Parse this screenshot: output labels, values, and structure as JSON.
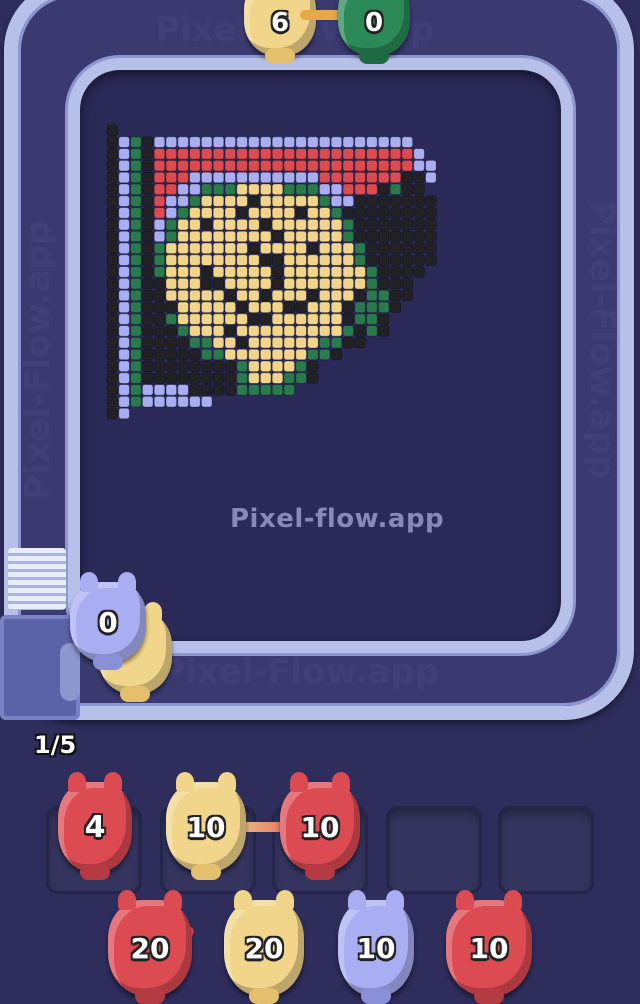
{
  "watermark": {
    "center": "Pixel-flow.app",
    "bottom_track": "Pixel-Flow.app",
    "top_track": "Pixel-Flow.app",
    "side_track": "Pixel-Flow.app"
  },
  "level_progress": "1/5",
  "colors": {
    "red": "#dc4a52",
    "yellow": "#f1d58a",
    "blue": "#a9aef2",
    "green": "#2b7a4e",
    "black": "#222226"
  },
  "track_pigs": [
    {
      "count": "6",
      "color": "yellow"
    },
    {
      "count": "0",
      "color": "green"
    },
    {
      "count": "0",
      "color": "blue"
    }
  ],
  "slots": [
    {
      "count": "4",
      "color": "red"
    },
    {
      "count": "10",
      "color": "yellow"
    },
    {
      "count": "10",
      "color": "red"
    },
    {
      "count": "",
      "color": "empty"
    },
    {
      "count": "",
      "color": "empty"
    }
  ],
  "queue": [
    {
      "count": "20",
      "color": "red"
    },
    {
      "count": "20",
      "color": "yellow"
    },
    {
      "count": "10",
      "color": "blue"
    },
    {
      "count": "10",
      "color": "red"
    }
  ],
  "pixel_art_rows": [
    "K...........................",
    "KBGKBBBBBBBBBBBBBBBBBBBBBB..",
    "KBGKRRRRRRRRRRRRRRRRRRRRRRB.",
    "KBGKRRRRRRRRRRRRRRRRRRRRRRBB",
    "KBGKRRRBBBBBBBBBBBRRRRRRRKKB",
    "KBGKRRBBGGGYYYYGGGBBRRRKGKK.",
    "KBGKRBBGYYYYKYYYYYGBBKKKKKKK",
    "KBGKRBGYYYYKYYYYKYYGKKKKKKKK",
    "KBGKBGYYKYYYYKYYYYYYGKKKKKKK",
    "KBGKBGYYYYYYYYKYYYYYGKKKKKKK",
    "KBGKGYYYYYYYKYYYYKYYYGKKKKKK",
    "KBGKGYYYYYYYYKKYYYYYYGKKKKKK",
    "KBGKGYYYKYYYYYKYYYYYYYGKKKK.",
    "KBGKKYYYKKYYYYKYYYYYYYGKKK..",
    "KBGKKYYYYYKYYKYYYKYYYKGGKK..",
    "KBGKKKYYYYYKYYYKKYYYKGGGK...",
    "KBGKKGYYYYYYKKYYYYYYKGGK....",
    "KBGKKKGYYYKYYYYYYYYYGKGK....",
    "KBGKKKKGGYYKYYYYYYGGKK......",
    "KBGKKKKKGGYYYYYYYGGK........",
    "KBGKKKKKKKKGYYYYGK..........",
    "KBGKKKKKKKKGYYYGGK..........",
    "KBGBBBBKKKKGGGGG............",
    "KBGBBBBBB...................",
    "KB.........................."
  ]
}
